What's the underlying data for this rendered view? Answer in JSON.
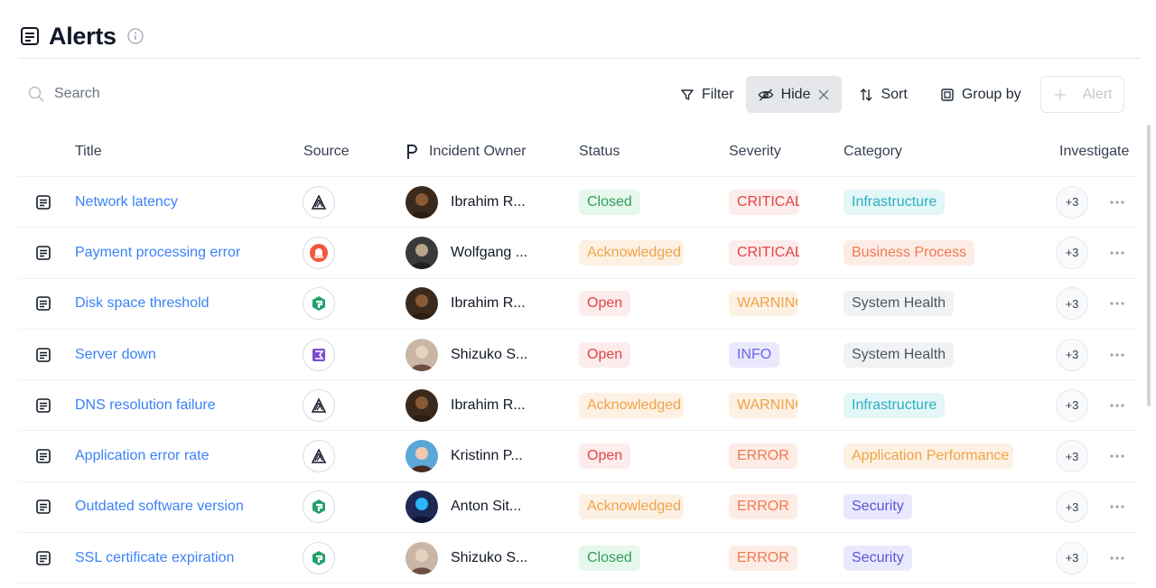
{
  "page": {
    "title": "Alerts"
  },
  "search": {
    "placeholder": "Search"
  },
  "toolbar": {
    "filter_label": "Filter",
    "hide_label": "Hide",
    "sort_label": "Sort",
    "group_by_label": "Group by",
    "alert_label": "Alert"
  },
  "table": {
    "columns": {
      "title": "Title",
      "source": "Source",
      "owner": "Incident Owner",
      "status": "Status",
      "severity": "Severity",
      "category": "Category",
      "investigate": "Investigate"
    },
    "rows": [
      {
        "title": "Network latency",
        "source": "delta-triangle-icon",
        "owner": "Ibrahim R...",
        "status": "Closed",
        "severity": "CRITICAL",
        "category": "Infrastructure",
        "investigators": "+3"
      },
      {
        "title": "Payment processing error",
        "source": "red-alarm-icon",
        "owner": "Wolfgang ...",
        "status": "Acknowledged",
        "severity": "CRITICAL",
        "category": "Business Process",
        "investigators": "+3"
      },
      {
        "title": "Disk space threshold",
        "source": "green-box-icon",
        "owner": "Ibrahim R...",
        "status": "Open",
        "severity": "WARNING",
        "category": "System Health",
        "investigators": "+3"
      },
      {
        "title": "Server down",
        "source": "purple-flag-icon",
        "owner": "Shizuko S...",
        "status": "Open",
        "severity": "INFO",
        "category": "System Health",
        "investigators": "+3"
      },
      {
        "title": "DNS resolution failure",
        "source": "delta-triangle-icon",
        "owner": "Ibrahim R...",
        "status": "Acknowledged",
        "severity": "WARNING",
        "category": "Infrastructure",
        "investigators": "+3"
      },
      {
        "title": "Application error rate",
        "source": "delta-triangle-icon",
        "owner": "Kristinn P...",
        "status": "Open",
        "severity": "ERROR",
        "category": "Application Performance",
        "investigators": "+3"
      },
      {
        "title": "Outdated software version",
        "source": "green-box-icon",
        "owner": "Anton Sit...",
        "status": "Acknowledged",
        "severity": "ERROR",
        "category": "Security",
        "investigators": "+3"
      },
      {
        "title": "SSL certificate expiration",
        "source": "green-box-icon",
        "owner": "Shizuko S...",
        "status": "Closed",
        "severity": "ERROR",
        "category": "Security",
        "investigators": "+3"
      }
    ]
  },
  "colors": {
    "link": "#3b82f6",
    "status_closed_bg": "#e6f7ec",
    "status_closed_fg": "#2f9e58",
    "status_open_bg": "#fdecec",
    "status_open_fg": "#e04545",
    "status_ack_bg": "#fdf1e3",
    "status_ack_fg": "#f0a24a",
    "sev_critical_bg": "#fdecec",
    "sev_critical_fg": "#e04545",
    "sev_warning_bg": "#fdf1e3",
    "sev_warning_fg": "#f0a24a",
    "sev_info_bg": "#e9e8fd",
    "sev_info_fg": "#6b66e6",
    "sev_error_bg": "#fdece6",
    "sev_error_fg": "#ef7a4e"
  }
}
